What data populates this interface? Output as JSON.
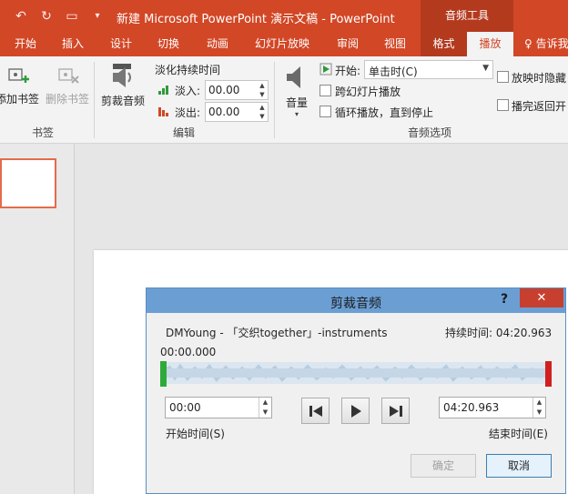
{
  "window": {
    "title": "新建 Microsoft PowerPoint 演示文稿 - PowerPoint",
    "context_tab_group": "音频工具"
  },
  "tabs": [
    "开始",
    "插入",
    "设计",
    "切换",
    "动画",
    "幻灯片放映",
    "审阅",
    "视图",
    "格式",
    "播放"
  ],
  "active_tab": "播放",
  "tell_me": "告诉我",
  "ribbon": {
    "bookmarks": {
      "add": "添加书签",
      "remove": "删除书签",
      "group_label": "书签"
    },
    "editing": {
      "trim_audio": "剪裁音频",
      "fade_duration": "淡化持续时间",
      "fade_in_label": "淡入:",
      "fade_in_value": "00.00",
      "fade_out_label": "淡出:",
      "fade_out_value": "00.00",
      "group_label": "编辑"
    },
    "audio_options": {
      "volume": "音量",
      "start_label": "开始:",
      "start_value": "单击时(C)",
      "play_across_slides": "跨幻灯片播放",
      "loop_until_stopped": "循环播放，直到停止",
      "hide_during_show": "放映时隐藏",
      "rewind_after_playing": "播完返回开",
      "group_label": "音频选项"
    }
  },
  "dialog": {
    "title": "剪裁音频",
    "help": "?",
    "close": "✕",
    "track_name": "DMYoung - 「交织together」-instruments",
    "duration_label": "持续时间: 04:20.963",
    "current_time": "00:00.000",
    "start_time_value": "00:00",
    "start_time_label": "开始时间(S)",
    "end_time_value": "04:20.963",
    "end_time_label": "结束时间(E)",
    "ok": "确定",
    "cancel": "取消"
  }
}
